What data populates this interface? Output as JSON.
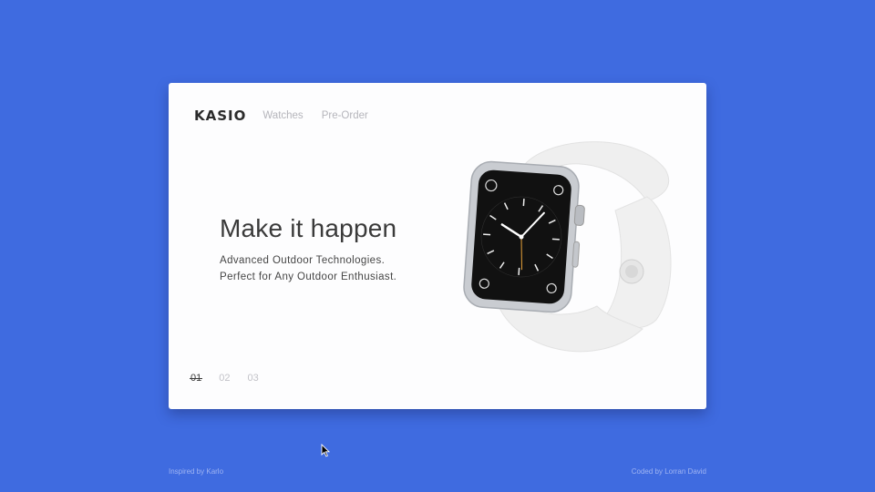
{
  "nav": {
    "logo": "KASIO",
    "links": [
      "Watches",
      "Pre-Order"
    ]
  },
  "hero": {
    "headline": "Make it happen",
    "sub_line_1": "Advanced Outdoor Technologies.",
    "sub_line_2": "Perfect for Any Outdoor Enthusiast."
  },
  "pager": {
    "items": [
      "01",
      "02",
      "03"
    ],
    "active_index": 0
  },
  "footer": {
    "left": "Inspired by Karlo",
    "right": "Coded by Lorran David"
  },
  "colors": {
    "background": "#3f6be0",
    "card": "#fdfdfe",
    "accent_text": "#3a3a3a"
  },
  "icons": {
    "product": "smartwatch-image",
    "pointer": "mouse-cursor-icon"
  }
}
